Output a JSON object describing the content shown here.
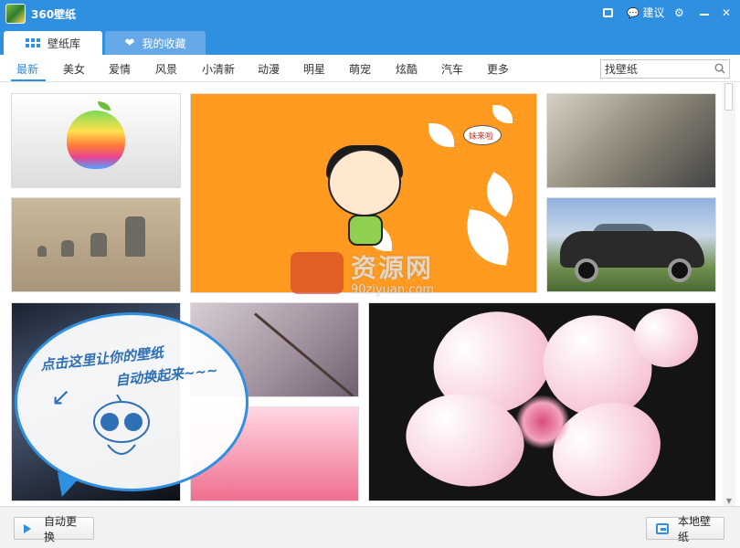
{
  "window": {
    "title": "360壁纸",
    "feedback_label": "建议",
    "skin_icon": "skin-icon",
    "settings_icon": "gear-icon",
    "minimize_icon": "minimize-icon",
    "close_icon": "close-icon",
    "close_glyph": "✕",
    "settings_glyph": "⚙",
    "feedback_glyph": "💬"
  },
  "tabs": [
    {
      "label": "壁纸库",
      "active": true,
      "icon": "grid-icon"
    },
    {
      "label": "我的收藏",
      "active": false,
      "icon": "heart-icon"
    }
  ],
  "heart_glyph": "❤",
  "categories": [
    "最新",
    "美女",
    "爱情",
    "风景",
    "小清新",
    "动漫",
    "明星",
    "萌宠",
    "炫酷",
    "汽车",
    "更多"
  ],
  "active_category": "最新",
  "search": {
    "placeholder": "找壁纸"
  },
  "thumbnails": [
    {
      "name": "apple-wallpaper"
    },
    {
      "name": "moai-wallpaper"
    },
    {
      "name": "cartoon-wallpaper"
    },
    {
      "name": "fantasy-girl-wallpaper"
    },
    {
      "name": "car-wallpaper"
    },
    {
      "name": "tunnel-wallpaper"
    },
    {
      "name": "branch-wallpaper"
    },
    {
      "name": "anime-wallpaper"
    },
    {
      "name": "flower-wallpaper"
    }
  ],
  "cartoon_bubble_text": "妹来啦",
  "speech_bubble": {
    "line1": "点击这里让你的壁纸",
    "line2": "自动换起来~~~"
  },
  "watermark": {
    "cn": "资源网",
    "en": "90ziyuan.com"
  },
  "footer": {
    "auto_change_label": "自动更换",
    "local_wallpaper_label": "本地壁纸"
  },
  "colors": {
    "accent": "#2f8fe0",
    "tab_inactive": "#66a9e9"
  }
}
